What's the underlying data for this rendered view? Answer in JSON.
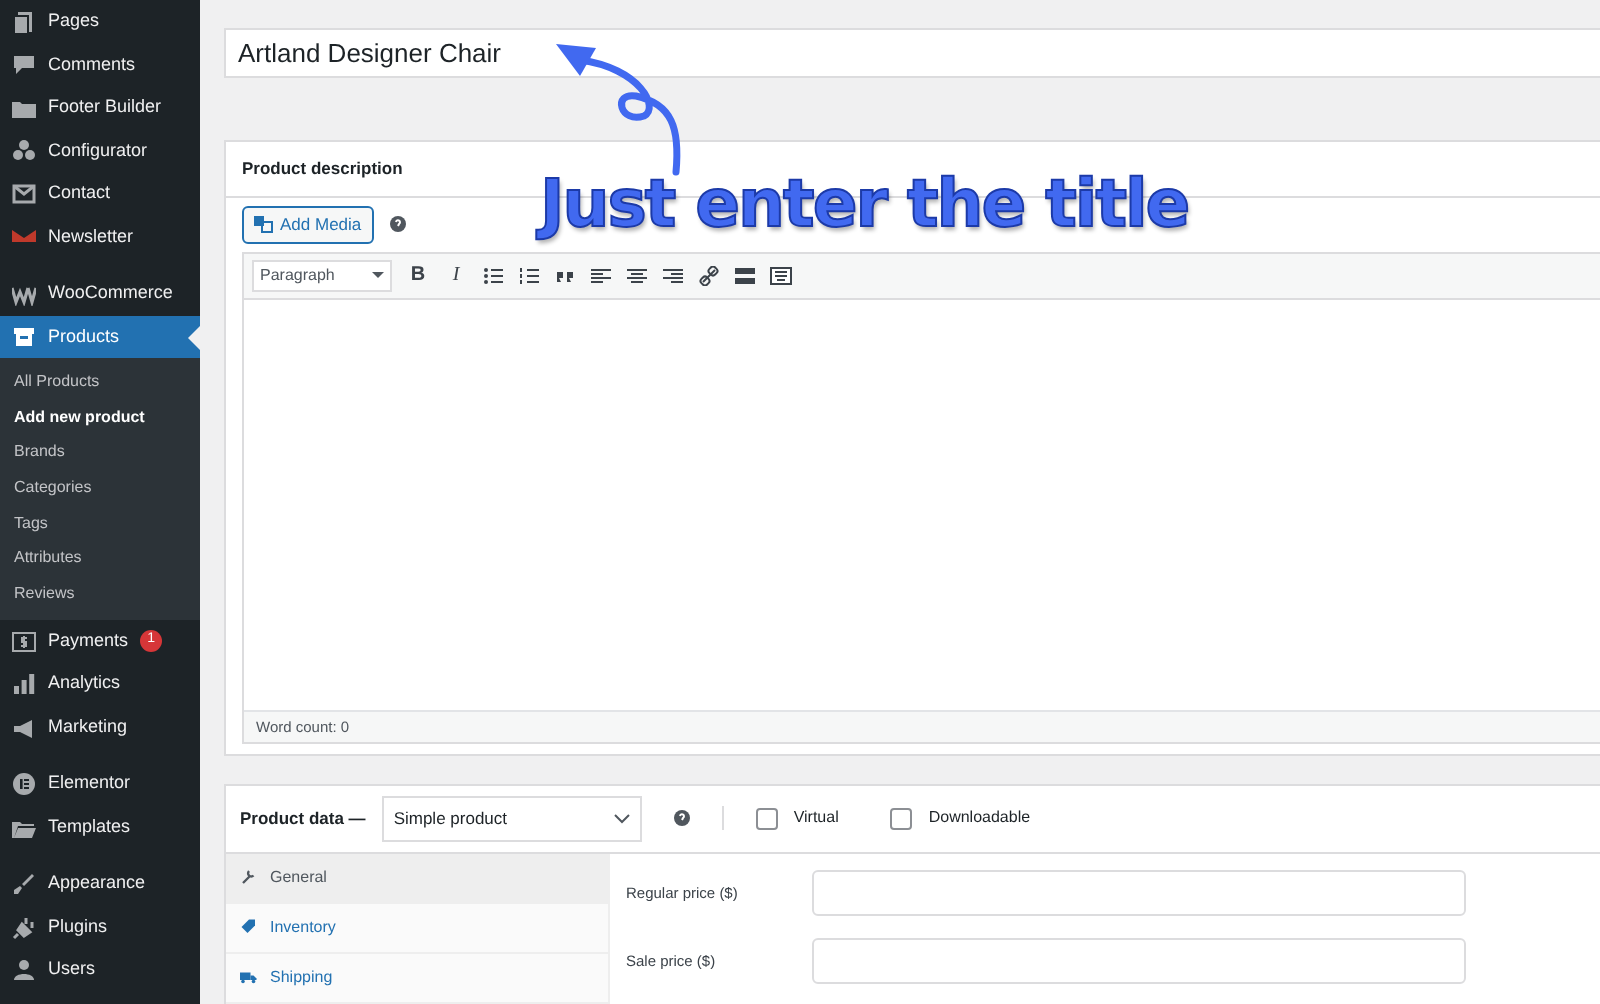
{
  "sidebar": {
    "groups": [
      {
        "items": [
          {
            "label": "Pages",
            "selected": false
          },
          {
            "label": "Comments",
            "selected": false
          },
          {
            "label": "Footer Builder",
            "selected": false
          },
          {
            "label": "Configurator",
            "selected": false
          },
          {
            "label": "Contact",
            "selected": false
          },
          {
            "label": "Newsletter",
            "selected": false
          }
        ]
      },
      {
        "items": [
          {
            "label": "WooCommerce",
            "selected": false
          },
          {
            "label": "Products",
            "selected": true,
            "children": [
              {
                "label": "All Products",
                "selected": false
              },
              {
                "label": "Add new product",
                "selected": true
              },
              {
                "label": "Brands",
                "selected": false
              },
              {
                "label": "Categories",
                "selected": false
              },
              {
                "label": "Tags",
                "selected": false
              },
              {
                "label": "Attributes",
                "selected": false
              },
              {
                "label": "Reviews",
                "selected": false
              }
            ]
          },
          {
            "label": "Payments",
            "selected": false,
            "badge": "1"
          },
          {
            "label": "Analytics",
            "selected": false
          },
          {
            "label": "Marketing",
            "selected": false
          }
        ]
      },
      {
        "items": [
          {
            "label": "Elementor",
            "selected": false
          },
          {
            "label": "Templates",
            "selected": false
          }
        ]
      },
      {
        "items": [
          {
            "label": "Appearance",
            "selected": false
          },
          {
            "label": "Plugins",
            "selected": false
          },
          {
            "label": "Users",
            "selected": false
          }
        ]
      }
    ]
  },
  "title_field": {
    "value": "Artland Designer Chair"
  },
  "annotation": {
    "text": "Just enter the title"
  },
  "description": {
    "heading": "Product description",
    "add_media": "Add Media",
    "toolbar": [
      {
        "kind": "select",
        "label": "Paragraph"
      },
      {
        "kind": "bold",
        "label": "B"
      },
      {
        "kind": "italic",
        "label": "I"
      },
      {
        "kind": "bullets"
      },
      {
        "kind": "numbers"
      },
      {
        "kind": "quote"
      },
      {
        "kind": "align-left"
      },
      {
        "kind": "align-center"
      },
      {
        "kind": "align-right"
      },
      {
        "kind": "link"
      },
      {
        "kind": "more"
      },
      {
        "kind": "keyboard"
      }
    ],
    "word_count": "Word count: 0"
  },
  "product_data": {
    "heading": "Product data —",
    "type": "Simple product",
    "virtual": {
      "label": "Virtual",
      "checked": false
    },
    "downloadable": {
      "label": "Downloadable",
      "checked": false
    },
    "tabs": [
      {
        "label": "General",
        "selected": true
      },
      {
        "label": "Inventory",
        "selected": false
      },
      {
        "label": "Shipping",
        "selected": false
      }
    ],
    "fields": [
      {
        "label": "Regular price ($)"
      },
      {
        "label": "Sale price ($)"
      }
    ]
  }
}
